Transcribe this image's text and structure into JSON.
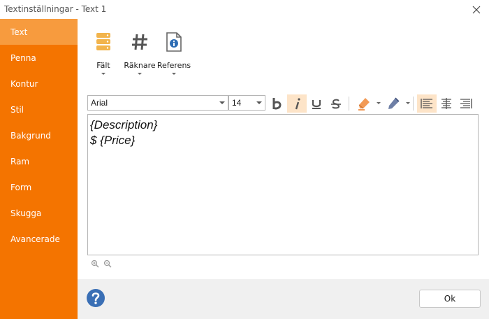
{
  "window": {
    "title": "Textinställningar - Text 1"
  },
  "sidebar": {
    "items": [
      {
        "label": "Text",
        "active": true
      },
      {
        "label": "Penna"
      },
      {
        "label": "Kontur"
      },
      {
        "label": "Stil"
      },
      {
        "label": "Bakgrund"
      },
      {
        "label": "Ram"
      },
      {
        "label": "Form"
      },
      {
        "label": "Skugga"
      },
      {
        "label": "Avancerade"
      }
    ]
  },
  "ribbon": {
    "field": {
      "label": "Fält",
      "icon": "database-icon"
    },
    "counter": {
      "label": "Räknare",
      "icon": "hash-icon"
    },
    "reference": {
      "label": "Referens",
      "icon": "document-info-icon"
    }
  },
  "toolbar": {
    "font": "Arial",
    "size": "14",
    "bold": false,
    "italic": true,
    "underline": false,
    "strikethrough": false,
    "align": "left"
  },
  "editor": {
    "line1": "{Description}",
    "line2": "$ {Price}"
  },
  "footer": {
    "ok_label": "Ok"
  },
  "colors": {
    "accent": "#f47400",
    "active_item": "#f79b3e",
    "footer_bg": "#f0f0f0"
  }
}
